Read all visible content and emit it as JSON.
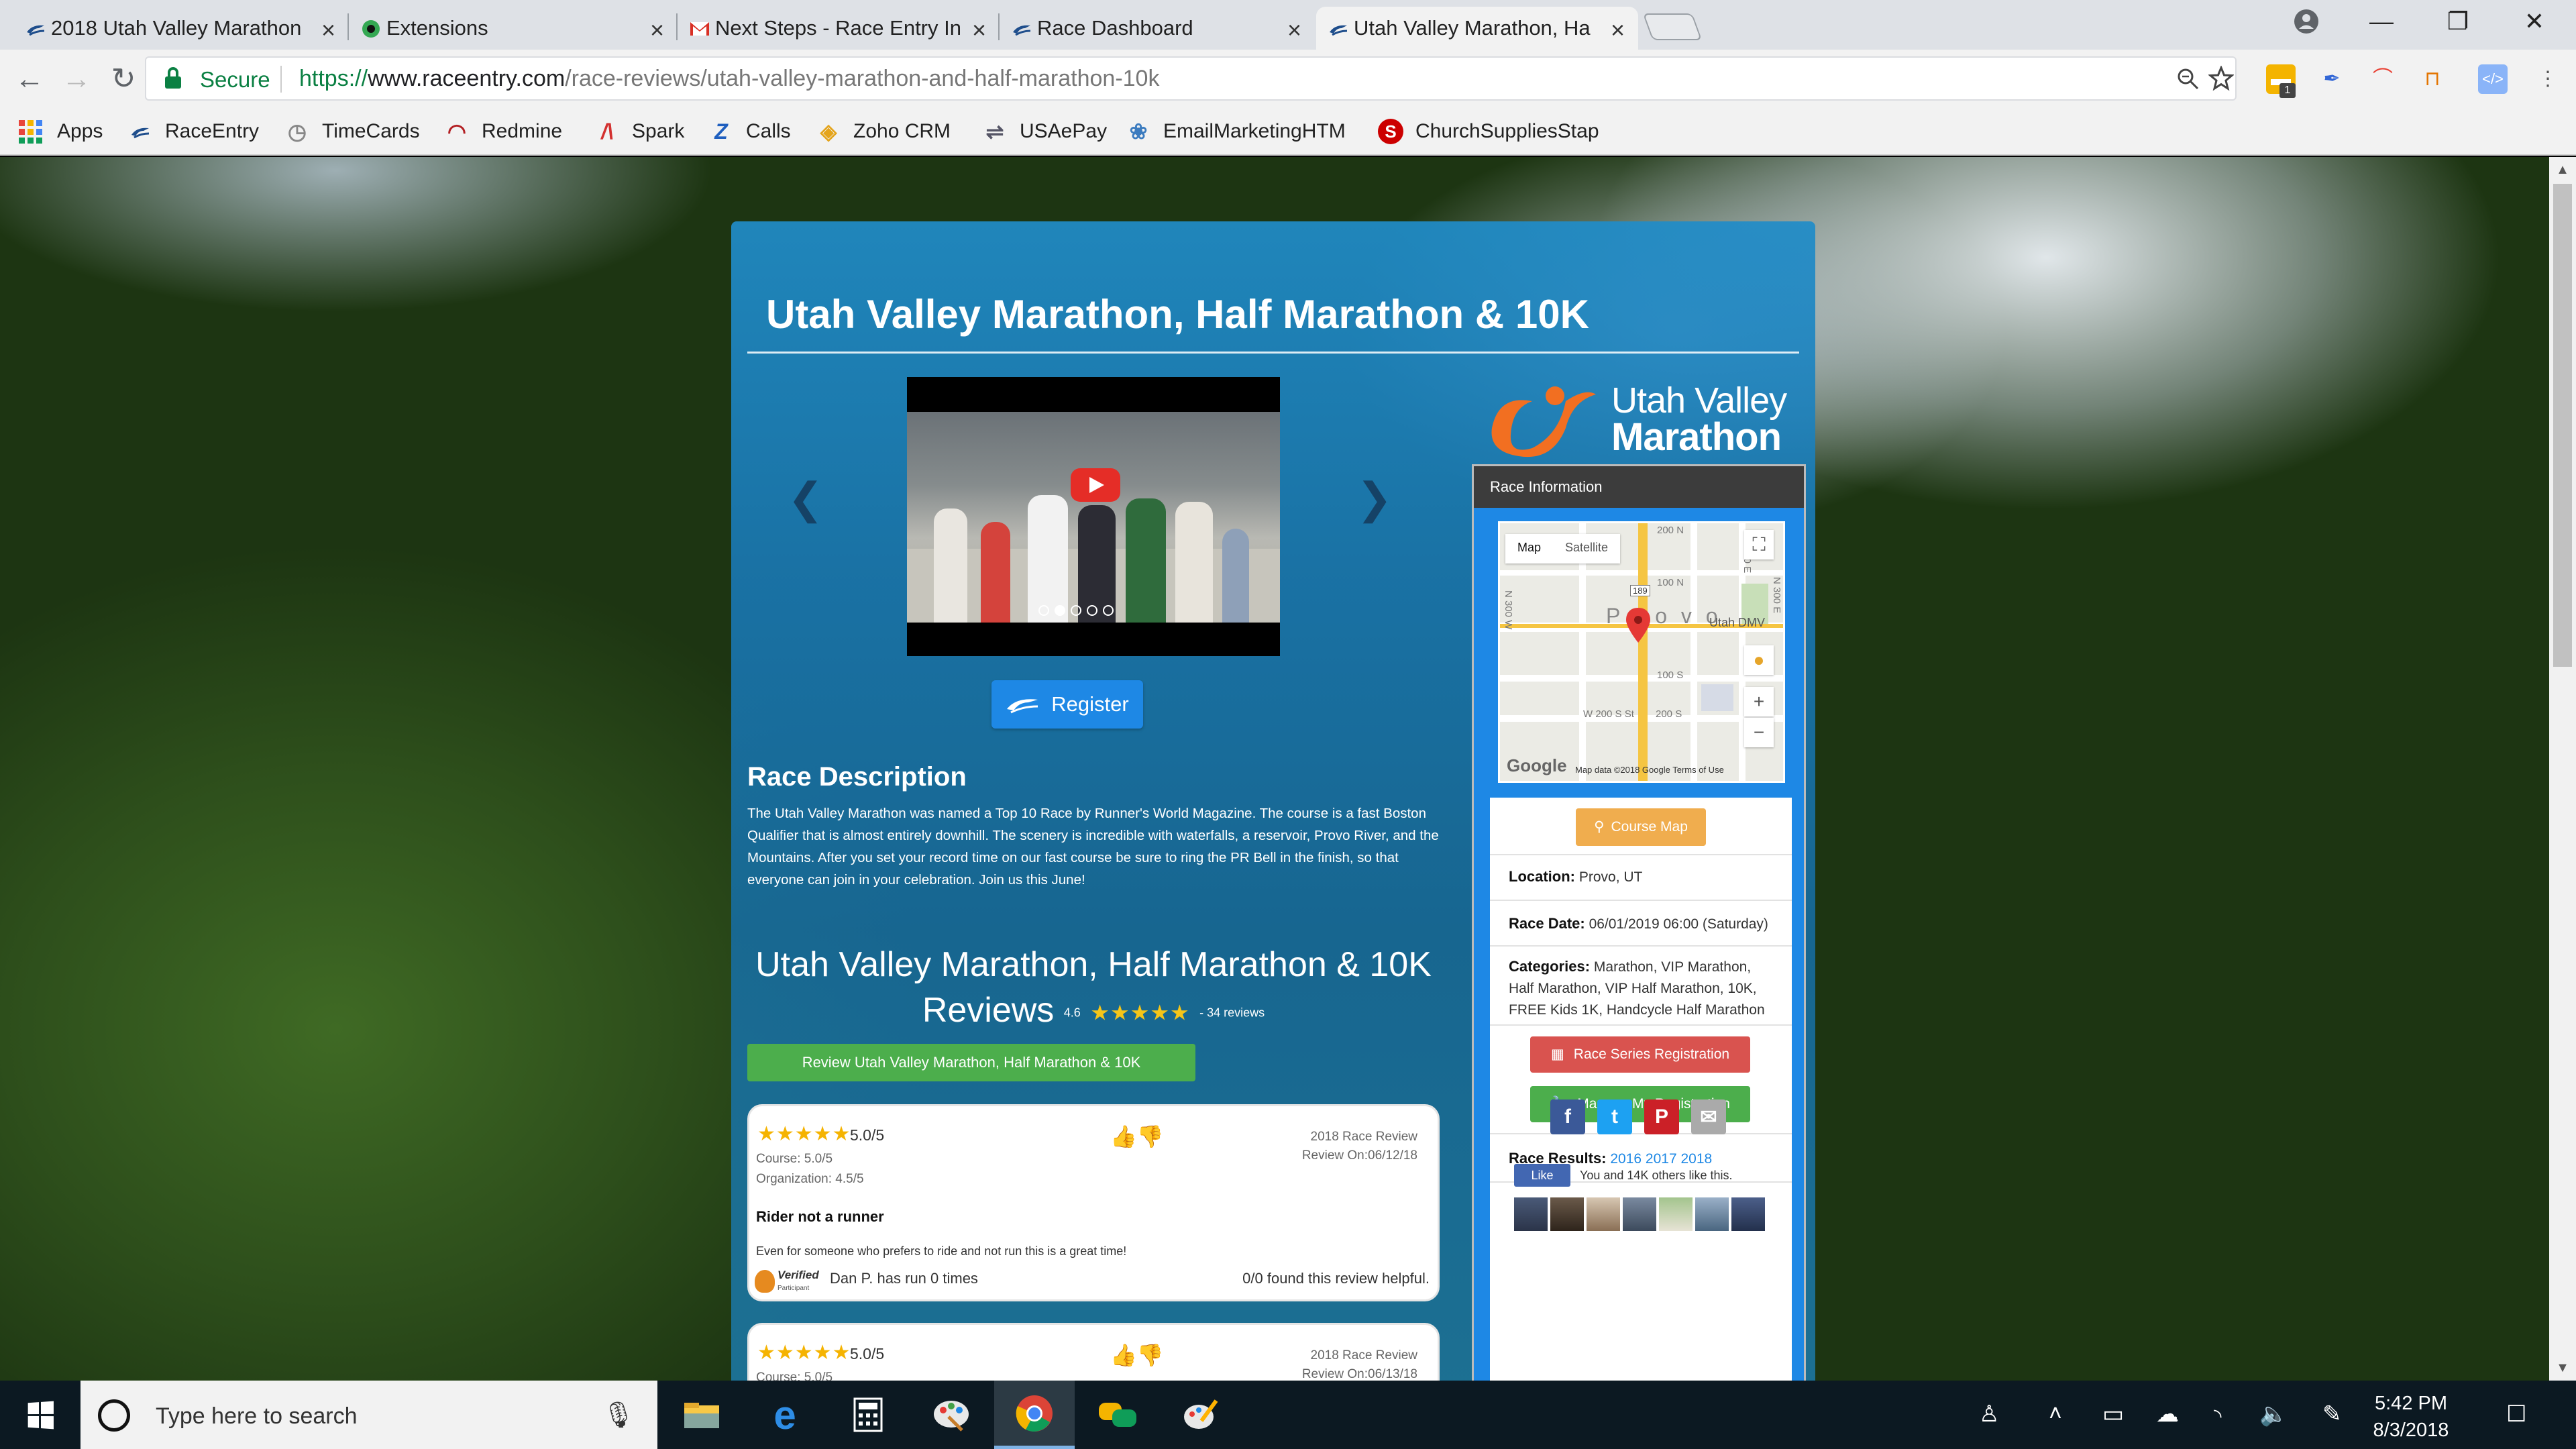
{
  "browser": {
    "tabs": [
      {
        "title": "2018 Utah Valley Marathon",
        "icon": "raceentry-logo-icon",
        "active": false
      },
      {
        "title": "Extensions",
        "icon": "extensions-icon",
        "active": false
      },
      {
        "title": "Next Steps - Race Entry In",
        "icon": "gmail-icon",
        "active": false
      },
      {
        "title": "Race Dashboard",
        "icon": "raceentry-logo-icon",
        "active": false
      },
      {
        "title": "Utah Valley Marathon, Ha",
        "icon": "raceentry-logo-icon",
        "active": true
      }
    ],
    "close_glyph": "×",
    "address": {
      "secure_label": "Secure",
      "url_scheme": "https://",
      "url_host": "www.raceentry.com",
      "url_path": "/race-reviews/utah-valley-marathon-and-half-marathon-10k"
    },
    "window_controls": {
      "minimize": "—",
      "restore": "❐",
      "close": "✕"
    },
    "extension_badge": "1"
  },
  "bookmarks": [
    {
      "label": "Apps",
      "icon": "apps-grid-icon"
    },
    {
      "label": "RaceEntry",
      "icon": "raceentry-logo-icon"
    },
    {
      "label": "TimeCards",
      "icon": "clock-icon"
    },
    {
      "label": "Redmine",
      "icon": "redmine-icon"
    },
    {
      "label": "Spark",
      "icon": "spark-icon"
    },
    {
      "label": "Calls",
      "icon": "zoho-z-icon"
    },
    {
      "label": "Zoho CRM",
      "icon": "zoho-crm-icon"
    },
    {
      "label": "USAePay",
      "icon": "usaepay-icon"
    },
    {
      "label": "EmailMarketingHTM",
      "icon": "email-marketing-icon"
    },
    {
      "label": "ChurchSuppliesStap",
      "icon": "staples-icon"
    }
  ],
  "race": {
    "title": "Utah Valley Marathon, Half Marathon & 10K",
    "register_label": "Register",
    "carousel_prev": "❮",
    "carousel_next": "❯",
    "carousel_dots": 5,
    "carousel_active_dot": 2,
    "description_heading": "Race Description",
    "description": "The Utah Valley Marathon was named a Top 10 Race by Runner's World Magazine. The course is a fast Boston Qualifier that is almost entirely downhill. The scenery is incredible with waterfalls, a reservoir, Provo River, and the Mountains. After you set your record time on our fast course be sure to ring the PR Bell in the finish, so that everyone can join in your celebration. Join us this June!",
    "reviews_heading_line1": "Utah Valley Marathon, Half Marathon & 10K",
    "reviews_heading_word": "Reviews",
    "rating": "4.6",
    "rating_stars": "★★★★★",
    "review_count": "- 34 reviews",
    "write_review_label": "Review Utah Valley Marathon, Half Marathon & 10K"
  },
  "reviews": [
    {
      "stars": "★★★★★",
      "score": "5.0/5",
      "course": "Course: 5.0/5",
      "organization": "Organization: 4.5/5",
      "year_label": "2018 Race Review",
      "review_date": "Review On:06/12/18",
      "title": "Rider not a runner",
      "body": "Even for someone who prefers to ride and not run this is a great time!",
      "badge_line1": "Verified",
      "badge_line2": "Participant",
      "author": "Dan P. has run 0 times",
      "helpful": "0/0 found this review helpful."
    },
    {
      "stars": "★★★★★",
      "score": "5.0/5",
      "course": "Course: 5.0/5",
      "year_label": "2018 Race Review",
      "review_date": "Review On:06/13/18"
    }
  ],
  "thumbs": "👍👎",
  "sidebar": {
    "logo_line1": "Utah Valley",
    "logo_line2": "Marathon",
    "header": "Race Information",
    "map": {
      "tab_map": "Map",
      "tab_satellite": "Satellite",
      "place_provo": "P r o v o",
      "place_dmv": "Utah DMV",
      "google": "Google",
      "footer": "Map data ©2018 Google    Terms of Use",
      "labels": [
        "200 N",
        "100 N",
        "100 S",
        "200 S",
        "W 200 S St",
        "N 300 W",
        "N 200 E",
        "N 300 E",
        "189"
      ]
    },
    "course_map_label": "Course Map",
    "location_label": "Location:",
    "location_value": "Provo, UT",
    "race_date_label": "Race Date:",
    "race_date_value": "06/01/2019 06:00 (Saturday)",
    "categories_label": "Categories:",
    "categories_value": "Marathon, VIP Marathon, Half Marathon, VIP Half Marathon, 10K, FREE Kids 1K, Handcycle Half Marathon",
    "series_btn": "Race Series Registration",
    "manage_btn": "Manage My Registration",
    "results_label": "Race Results:",
    "results_years": [
      "2016",
      "2017",
      "2018"
    ],
    "share": [
      {
        "label": "f",
        "color": "#3b5998",
        "icon": "facebook-icon"
      },
      {
        "label": "t",
        "color": "#1da1f2",
        "icon": "twitter-icon"
      },
      {
        "label": "P",
        "color": "#cb2027",
        "icon": "pinterest-icon"
      },
      {
        "label": "✉",
        "color": "#aaaaaa",
        "icon": "email-icon"
      }
    ],
    "like_label": "Like",
    "like_text": "You and 14K others like this."
  },
  "taskbar": {
    "search_placeholder": "Type here to search",
    "time": "5:42 PM",
    "date": "8/3/2018"
  },
  "colors": {
    "accent_blue": "#1e88e5",
    "green": "#4cae4c",
    "orange": "#f0ad4e",
    "red": "#d9534f",
    "star_gold": "#f5c518"
  }
}
